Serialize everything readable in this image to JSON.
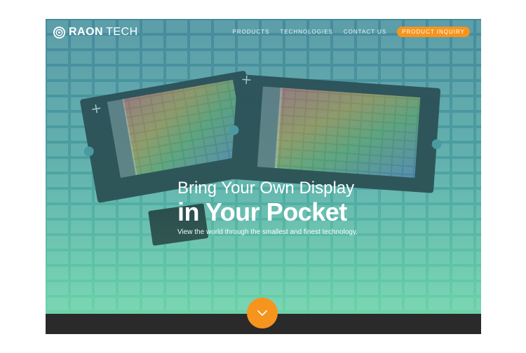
{
  "brand": {
    "name_part1": "RAON",
    "name_part2": "TECH",
    "logo_icon": "raontech-logo-icon"
  },
  "nav": {
    "links": [
      {
        "label": "PRODUCTS"
      },
      {
        "label": "TECHNOLOGIES"
      },
      {
        "label": "CONTACT US"
      }
    ],
    "cta_label": "PRODUCT INQUIRY"
  },
  "hero": {
    "headline_line1": "Bring Your Own Display",
    "headline_line2": "in Your Pocket",
    "subtext": "View the world through the smallest and finest technology."
  },
  "scroll_button": {
    "icon": "chevron-down-icon"
  },
  "colors": {
    "accent": "#f7941d",
    "hero_top": "#4d8fa0",
    "hero_bottom": "#6ccfa8",
    "bottom_bar": "#2a2a2a"
  }
}
